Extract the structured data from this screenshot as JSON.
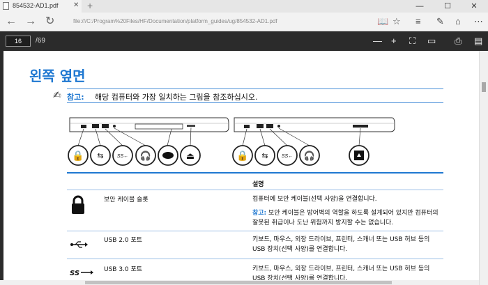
{
  "tab": {
    "title": "854532-AD1.pdf",
    "close": "✕",
    "new_tab": "+"
  },
  "window": {
    "minimize": "—",
    "maximize": "☐",
    "close": "✕"
  },
  "address": {
    "url": "file:///C:/Program%20Files/HF/Documentation/platform_guides/ug/854532-AD1.pdf"
  },
  "pdf_toolbar": {
    "page_number": "16",
    "page_total": "/69"
  },
  "document": {
    "heading": "왼쪽 옆면",
    "note_label": "참고:",
    "note_text": "해당 컴퓨터와 가장 일치하는 그림을 참조하십시오.",
    "table": {
      "header_desc": "설명",
      "rows": [
        {
          "name": "보안 케이블 슬롯",
          "desc": "컴퓨터에 보안 케이블(선택 사양)을 연결합니다.",
          "note_label": "참고:",
          "note_text": "보안 케이블은 방어벽의 역할을 하도록 설계되어 있지만 컴퓨터의 잘못된 취급이나 도난 위험까지 방지할 수는 없습니다."
        },
        {
          "name": "USB 2.0 포트",
          "desc": "키보드, 마우스, 외장 드라이브, 프린터, 스캐너 또는 USB 허브 등의 USB 장치(선택 사양)를 연결합니다."
        },
        {
          "name": "USB 3.0 포트",
          "desc": "키보드, 마우스, 외장 드라이브, 프린터, 스캐너 또는 USB 허브 등의 USB 장치(선택 사양)를 연결합니다."
        }
      ]
    }
  },
  "colors": {
    "accent": "#1f78d1",
    "toolbar": "#2b2b2b"
  }
}
